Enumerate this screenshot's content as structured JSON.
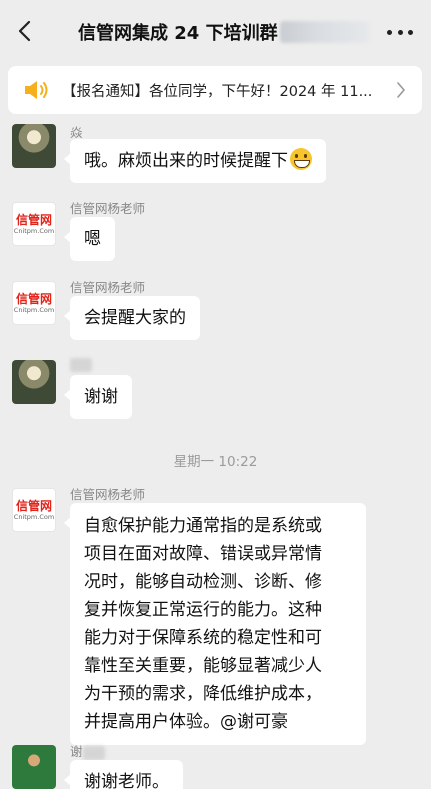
{
  "header": {
    "title": "信管网集成 24 下培训群"
  },
  "notice": {
    "text": "【报名通知】各位同学，下午好！2024 年 11..."
  },
  "messages": [
    {
      "sender": "焱",
      "text": "哦。麻烦出来的时候提醒下",
      "emoji": "grinning-face"
    },
    {
      "sender": "信管网杨老师",
      "text": "嗯"
    },
    {
      "sender": "信管网杨老师",
      "text": "会提醒大家的"
    },
    {
      "sender": "",
      "text": "谢谢"
    },
    {
      "timestamp": "星期一 10:22"
    },
    {
      "sender": "信管网杨老师",
      "lines": [
        "自愈保护能力通常指的是系统或",
        "项目在面对故障、错误或异常情",
        "况时，能够自动检测、诊断、修",
        "复并恢复正常运行的能力。这种",
        "能力对于保障系统的稳定性和可",
        "靠性至关重要，能够显著减少人",
        "为干预的需求，降低维护成本，",
        "并提高用户体验。@谢可豪"
      ]
    },
    {
      "sender": "谢",
      "text": "谢谢老师。"
    }
  ],
  "avatar_logo": {
    "line1": "信管网",
    "line2": "Cnitpm.Com"
  }
}
